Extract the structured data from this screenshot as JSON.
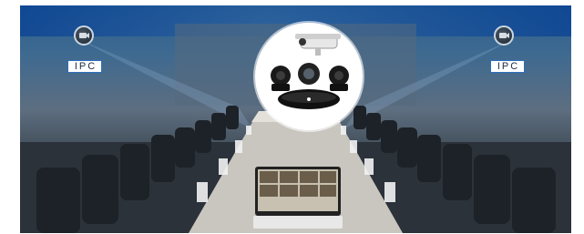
{
  "scene": {
    "left_label": "IPC",
    "right_label": "IPC",
    "icons": [
      "camera-icon",
      "camera-icon",
      "bullet-camera-icon",
      "ptz-camera-icon",
      "conference-camera-icon",
      "tablet-icon"
    ]
  }
}
